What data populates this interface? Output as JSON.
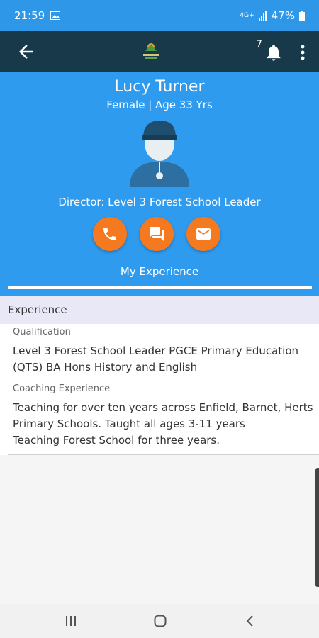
{
  "status_bar": {
    "time": "21:59",
    "network": "4G+",
    "battery": "47%"
  },
  "app_bar": {
    "notification_count": "7",
    "logo_alt": "THE FOREST",
    "colors": {
      "bar": "#18394a"
    }
  },
  "profile": {
    "name": "Lucy Turner",
    "subtitle": "Female | Age 33 Yrs",
    "role": "Director: Level 3 Forest School Leader",
    "tab_label": "My Experience",
    "colors": {
      "header": "#2f9bef",
      "action": "#f4791f"
    }
  },
  "experience": {
    "header": "Experience",
    "sections": [
      {
        "label": "Qualification",
        "text": "Level 3 Forest School Leader PGCE Primary Education (QTS) BA Hons History and English"
      },
      {
        "label": "Coaching Experience",
        "text": "Teaching for over ten years across Enfield, Barnet, Herts Primary Schools. Taught all ages 3-11 years\nTeaching Forest School for three years."
      }
    ]
  },
  "icons": {
    "back": "arrow-back-icon",
    "bell": "bell-icon",
    "more": "more-vertical-icon",
    "call": "phone-icon",
    "chat": "chat-icon",
    "mail": "mail-icon"
  }
}
